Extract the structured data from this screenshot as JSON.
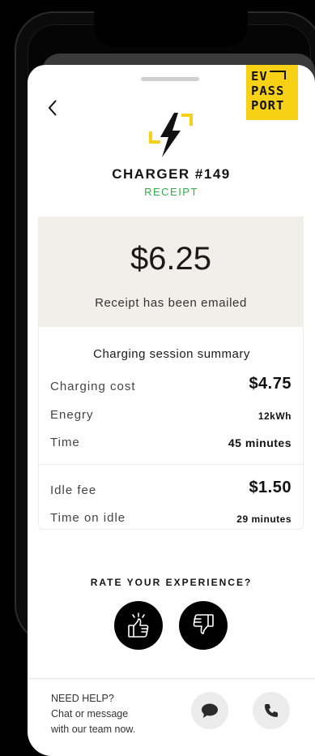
{
  "brand": {
    "line1": "EV",
    "line2": "PASS",
    "line3": "PORT"
  },
  "header": {
    "title": "CHARGER #149",
    "subtitle": "RECEIPT"
  },
  "total": {
    "amount": "$6.25",
    "note": "Receipt has been emailed"
  },
  "summary": {
    "title": "Charging session summary",
    "rows": [
      {
        "label": "Charging cost",
        "value": "$4.75"
      },
      {
        "label": "Enegry",
        "value": "12kWh"
      },
      {
        "label": "Time",
        "value": "45 minutes"
      },
      {
        "label": "Idle fee",
        "value": "$1.50"
      },
      {
        "label": "Time on idle",
        "value": "29 minutes"
      }
    ]
  },
  "rating": {
    "title": "RATE YOUR EXPERIENCE?",
    "like_icon": "thumbs-up-icon",
    "dislike_icon": "thumbs-down-icon"
  },
  "help": {
    "line1": "NEED HELP?",
    "line2": "Chat or message",
    "line3": "with our team now.",
    "chat_icon": "chat-bubble-icon",
    "call_icon": "phone-icon"
  },
  "colors": {
    "accent_yellow": "#f7d116",
    "accent_green": "#2fae4a",
    "box_bg": "#f0efe9"
  }
}
